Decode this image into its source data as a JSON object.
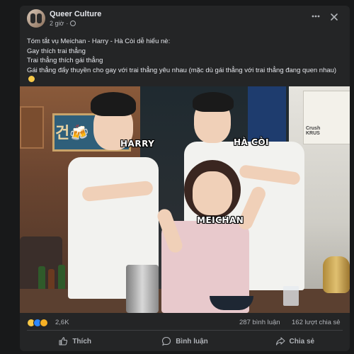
{
  "post": {
    "page_name": "Queer Culture",
    "time": "2 giờ",
    "caption_lines": [
      "Tóm tắt vụ Meichan - Harry - Hà Còi dễ hiểu nè:",
      "Gay thích trai thẳng",
      "Trai thẳng thích gái thẳng",
      "Gái thẳng đẩy thuyền cho gay với trai thẳng yêu nhau (mặc dù gái thẳng với trai thẳng đang quen nhau)"
    ],
    "photo_tags": {
      "left": "HARRY",
      "right": "HÀ CÒI",
      "center": "MEICHAN"
    },
    "photo_sign_text": "건🍻",
    "ad_text": "Crush\nKRUS"
  },
  "stats": {
    "reactions_count": "2,6K",
    "comments": "287 bình luận",
    "shares": "162 lượt chia sẻ"
  },
  "actions": {
    "like": "Thích",
    "comment": "Bình luận",
    "share": "Chia sẻ"
  },
  "icons": {
    "more": "more-horizontal-icon",
    "close": "close-icon",
    "privacy": "globe-icon"
  },
  "colors": {
    "background": "#18191a",
    "card": "#242526",
    "text_primary": "#e4e6eb",
    "text_secondary": "#b0b3b8",
    "like_blue": "#2d88ff"
  }
}
